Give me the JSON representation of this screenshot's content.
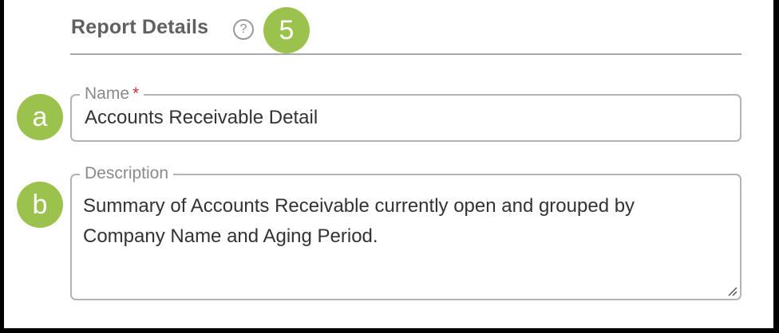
{
  "section": {
    "title": "Report Details",
    "help_icon": "question-circle-icon",
    "help_glyph": "?"
  },
  "markers": {
    "step": "5",
    "name_marker": "a",
    "description_marker": "b"
  },
  "fields": {
    "name": {
      "label": "Name",
      "required_mark": "*",
      "value": "Accounts Receivable Detail"
    },
    "description": {
      "label": "Description",
      "value": "Summary of Accounts Receivable currently open and grouped by Company Name and Aging Period."
    }
  },
  "colors": {
    "marker": "#9cc24e",
    "required": "#c0333a",
    "border": "#b3b3b3"
  }
}
